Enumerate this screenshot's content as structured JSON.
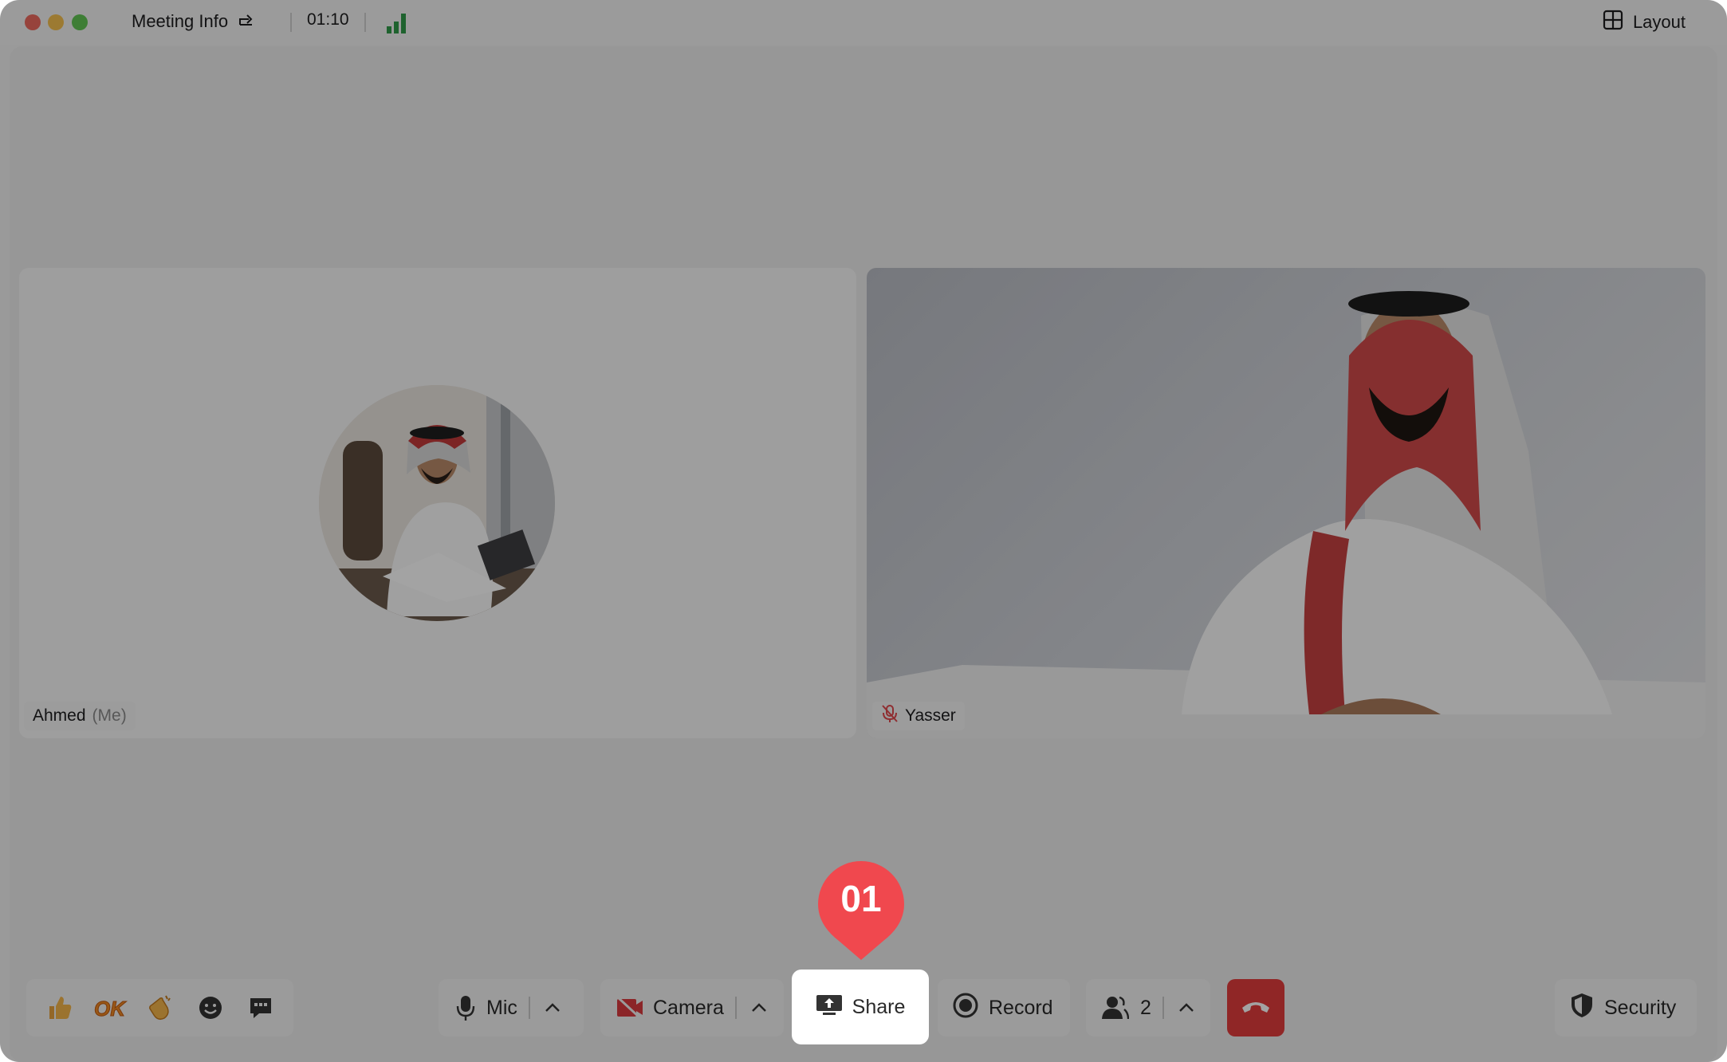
{
  "titlebar": {
    "meeting_info": "Meeting Info",
    "timer": "01:10",
    "layout": "Layout"
  },
  "participants": {
    "left": {
      "name": "Ahmed",
      "suffix": "(Me)"
    },
    "right": {
      "name": "Yasser",
      "muted": true
    }
  },
  "toolbar": {
    "reactions": [
      "thumbs-up",
      "ok",
      "clap",
      "smile",
      "chat"
    ],
    "reaction_ok_label": "OK",
    "mic": "Mic",
    "camera": "Camera",
    "share": "Share",
    "record": "Record",
    "participants_count": "2",
    "security": "Security"
  },
  "annotation": {
    "step": "01",
    "color": "#f0484e"
  },
  "colors": {
    "leave": "#e23c3c",
    "signal": "#2f9a48"
  }
}
